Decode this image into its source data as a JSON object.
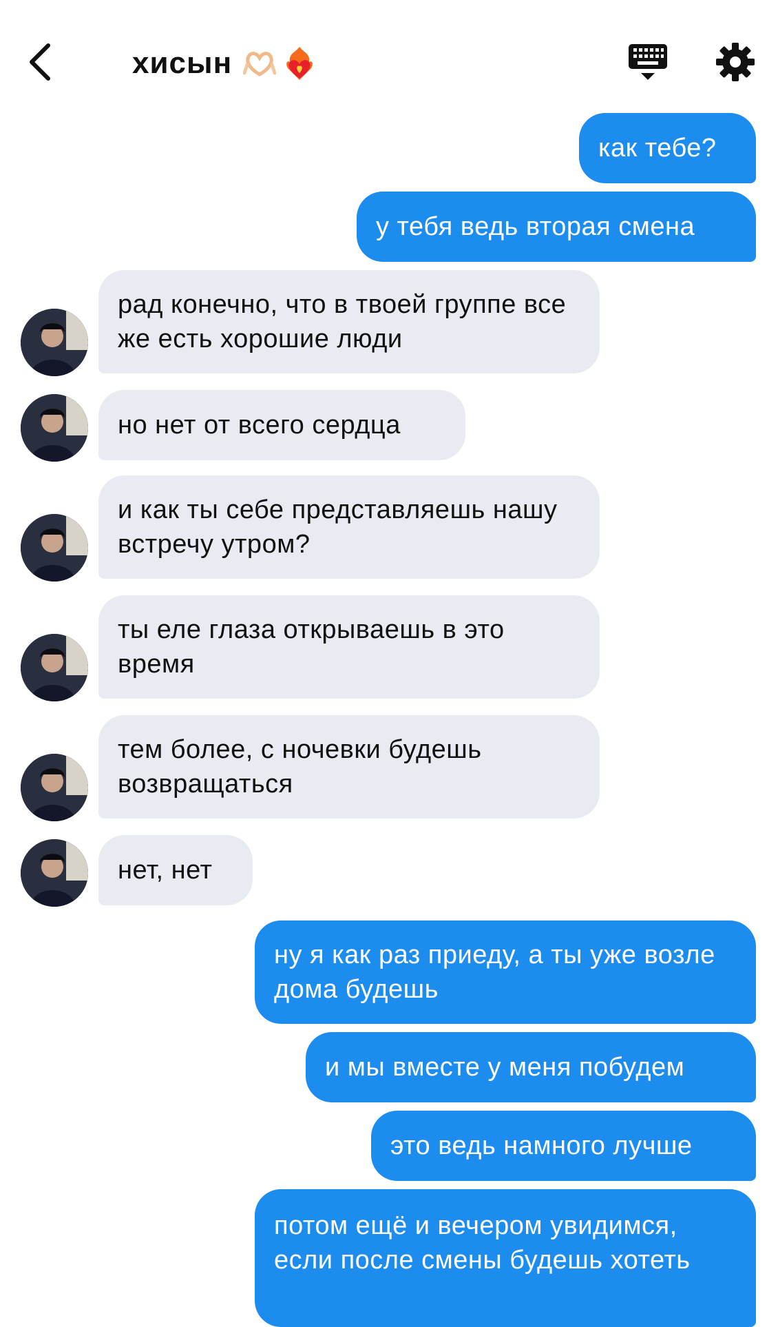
{
  "header": {
    "title": "хисын",
    "back_icon": "chevron-left-icon",
    "keyboard_icon": "keyboard-icon",
    "settings_icon": "gear-icon",
    "emoji": [
      "heart-hands-emoji",
      "heart-on-fire-emoji"
    ]
  },
  "colors": {
    "outgoing_bubble": "#1c8cef",
    "incoming_bubble": "#e9ebf2",
    "outgoing_text": "#ffffff",
    "incoming_text": "#111111"
  },
  "messages": [
    {
      "side": "out",
      "text": "как тебе?"
    },
    {
      "side": "out",
      "text": "у тебя ведь вторая смена"
    },
    {
      "side": "in",
      "text": "рад конечно, что в твоей группе все же есть хорошие люди"
    },
    {
      "side": "in",
      "text": "но нет от всего сердца"
    },
    {
      "side": "in",
      "text": "и как ты себе представляешь нашу встречу утром?"
    },
    {
      "side": "in",
      "text": "ты еле глаза открываешь в это время"
    },
    {
      "side": "in",
      "text": "тем более, с ночевки будешь возвращаться"
    },
    {
      "side": "in",
      "text": "нет, нет"
    },
    {
      "side": "out",
      "text": "ну я как раз приеду, а ты уже возле дома будешь"
    },
    {
      "side": "out",
      "text": "и мы вместе у меня побудем"
    },
    {
      "side": "out",
      "text": "это ведь намного лучше"
    },
    {
      "side": "out",
      "text": "потом ещё и вечером увидимся, если после смены будешь хотеть"
    }
  ]
}
